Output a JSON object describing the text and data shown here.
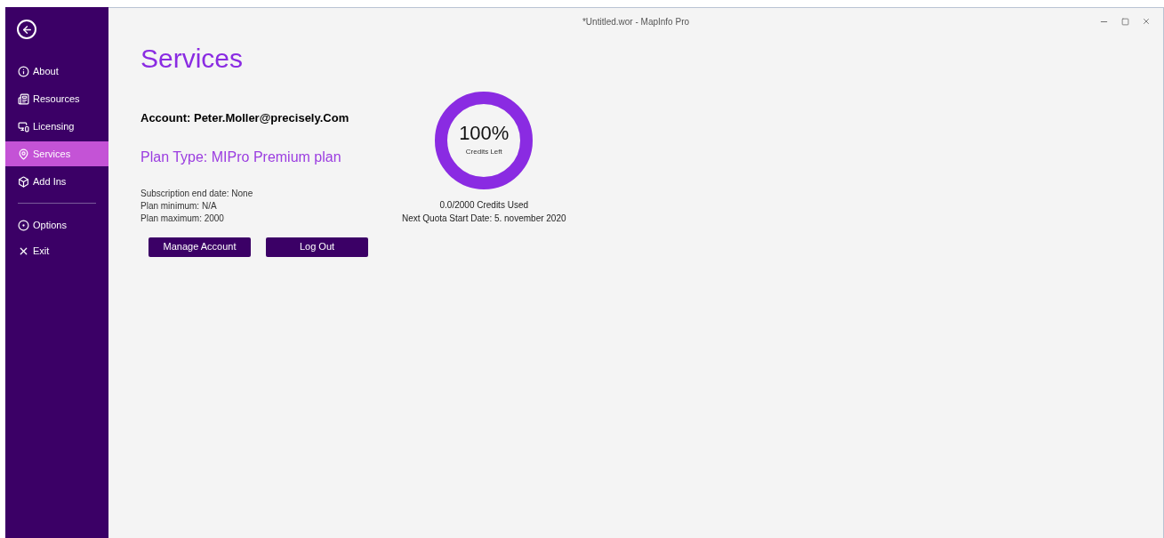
{
  "window": {
    "title": "*Untitled.wor - MapInfo Pro"
  },
  "sidebar": {
    "items": [
      {
        "label": "About",
        "selected": false
      },
      {
        "label": "Resources",
        "selected": false
      },
      {
        "label": "Licensing",
        "selected": false
      },
      {
        "label": "Services",
        "selected": true
      },
      {
        "label": "Add Ins",
        "selected": false
      }
    ],
    "footer_items": [
      {
        "label": "Options",
        "selected": false
      },
      {
        "label": "Exit",
        "selected": false
      }
    ]
  },
  "page": {
    "title": "Services",
    "account": {
      "label": "Account:",
      "value": "Peter.Moller@precisely.Com"
    },
    "plan_type": {
      "label": "Plan Type:",
      "value": "MIPro Premium plan"
    },
    "details": [
      {
        "label": "Subscription end date:",
        "value": "None"
      },
      {
        "label": "Plan minimum:",
        "value": "N/A"
      },
      {
        "label": "Plan maximum:",
        "value": "2000"
      }
    ],
    "buttons": [
      "Manage Account",
      "Log Out"
    ],
    "credits": {
      "percent": "100%",
      "caption": "Credits Left",
      "level": 1,
      "used": "0.0/2000 Credits Used",
      "next_quota": "Next Quota Start Date: 5. november 2020"
    }
  }
}
